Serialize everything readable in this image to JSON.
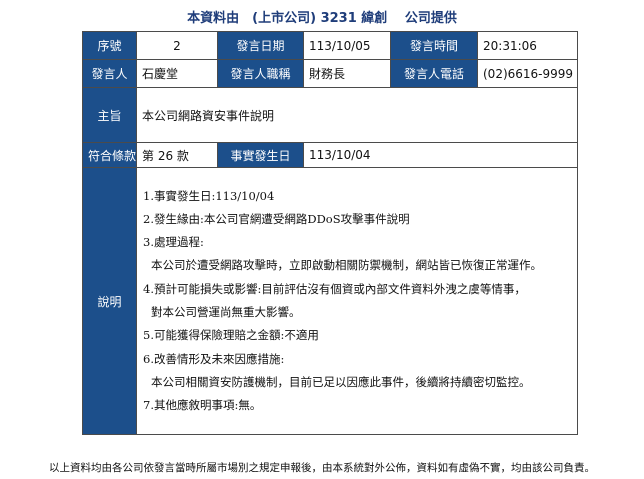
{
  "title": "本資料由　(上市公司) 3231 緯創　 公司提供",
  "rows": {
    "seq_label": "序號",
    "seq_value": "2",
    "date_label": "發言日期",
    "date_value": "113/10/05",
    "time_label": "發言時間",
    "time_value": "20:31:06",
    "speaker_label": "發言人",
    "speaker_value": "石慶堂",
    "position_label": "發言人職稱",
    "position_value": "財務長",
    "phone_label": "發言人電話",
    "phone_value": "(02)6616-9999",
    "subject_label": "主旨",
    "subject_value": "本公司網路資安事件說明",
    "clause_label": "符合條款",
    "clause_value": "第 26 款",
    "event_date_label": "事實發生日",
    "event_date_value": "113/10/04",
    "desc_label": "說明"
  },
  "description_lines": [
    "1.事實發生日:113/10/04",
    "2.發生緣由:本公司官網遭受網路DDoS攻擊事件說明",
    "3.處理過程:",
    "本公司於遭受網路攻擊時，立即啟動相關防禦機制，網站皆已恢復正常運作。",
    "4.預計可能損失或影響:目前評估沒有個資或內部文件資料外洩之虞等情事，",
    "對本公司營運尚無重大影響。",
    "5.可能獲得保險理賠之金額:不適用",
    "6.改善情形及未來因應措施:",
    "本公司相關資安防護機制，目前已足以因應此事件，後續將持續密切監控。",
    "7.其他應敘明事項:無。"
  ],
  "footer": "以上資料均由各公司依發言當時所屬市場別之規定申報後，由本系統對外公佈，資料如有虛偽不實，均由該公司負責。",
  "colors": {
    "label_bg": "#1c4f8b",
    "title_text": "#1f3d7a"
  }
}
